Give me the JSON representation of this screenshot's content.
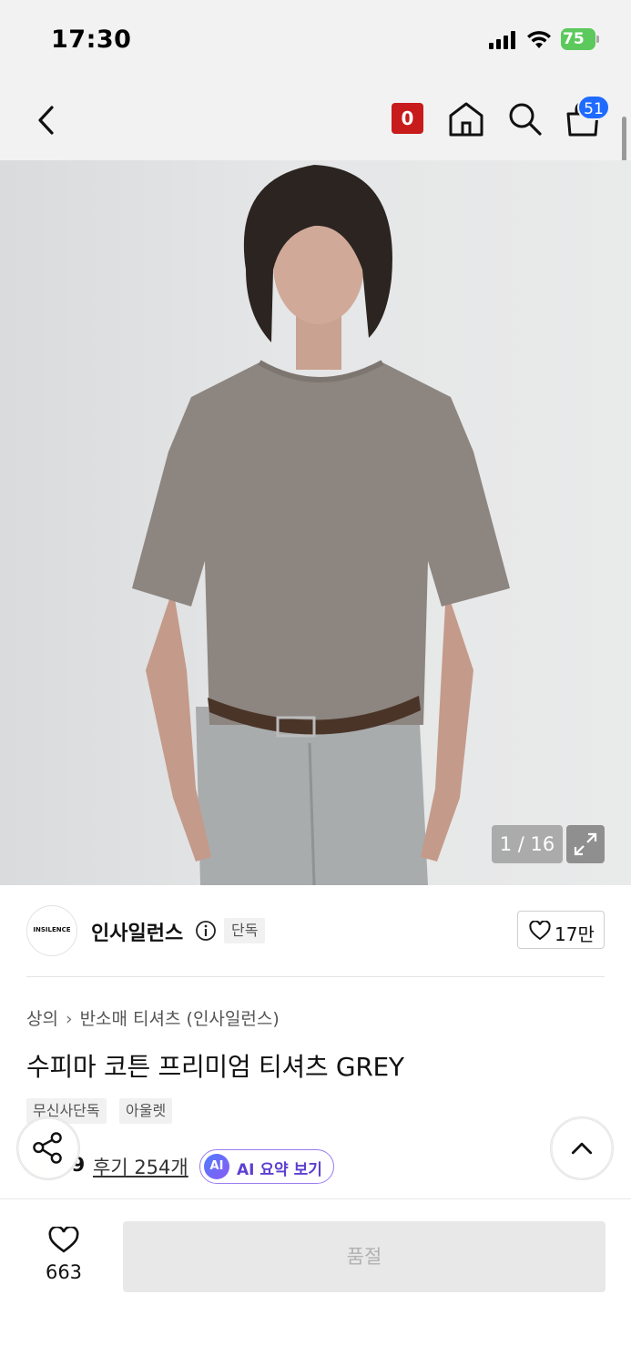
{
  "status_bar": {
    "time": "17:30",
    "battery": "75"
  },
  "header": {
    "points_badge": "0",
    "cart_count": "51",
    "icons": [
      "chevron-left-icon",
      "home-icon",
      "search-icon",
      "shopping-bag-icon"
    ]
  },
  "gallery": {
    "counter": "1 / 16"
  },
  "brand": {
    "logo_text": "INSILENCE",
    "name": "인사일런스",
    "tag": "단독",
    "likes": "17만"
  },
  "breadcrumb": [
    "상의",
    "반소매 티셔츠 (인사일런스)"
  ],
  "product": {
    "title": "수피마 코튼 프리미엄 티셔츠 GREY",
    "tags": [
      "무신사단독",
      "아울렛"
    ],
    "rating": "4.9",
    "reviews": "후기 254개",
    "ai_badge": "AI",
    "ai_summary": "AI 요약 보기"
  },
  "bottom_bar": {
    "wish_count": "663",
    "buy_label": "품절"
  },
  "colors": {
    "accent_red": "#c81b1b",
    "cart_badge": "#1f6bff",
    "ai_purple": "#5d3fd0"
  }
}
